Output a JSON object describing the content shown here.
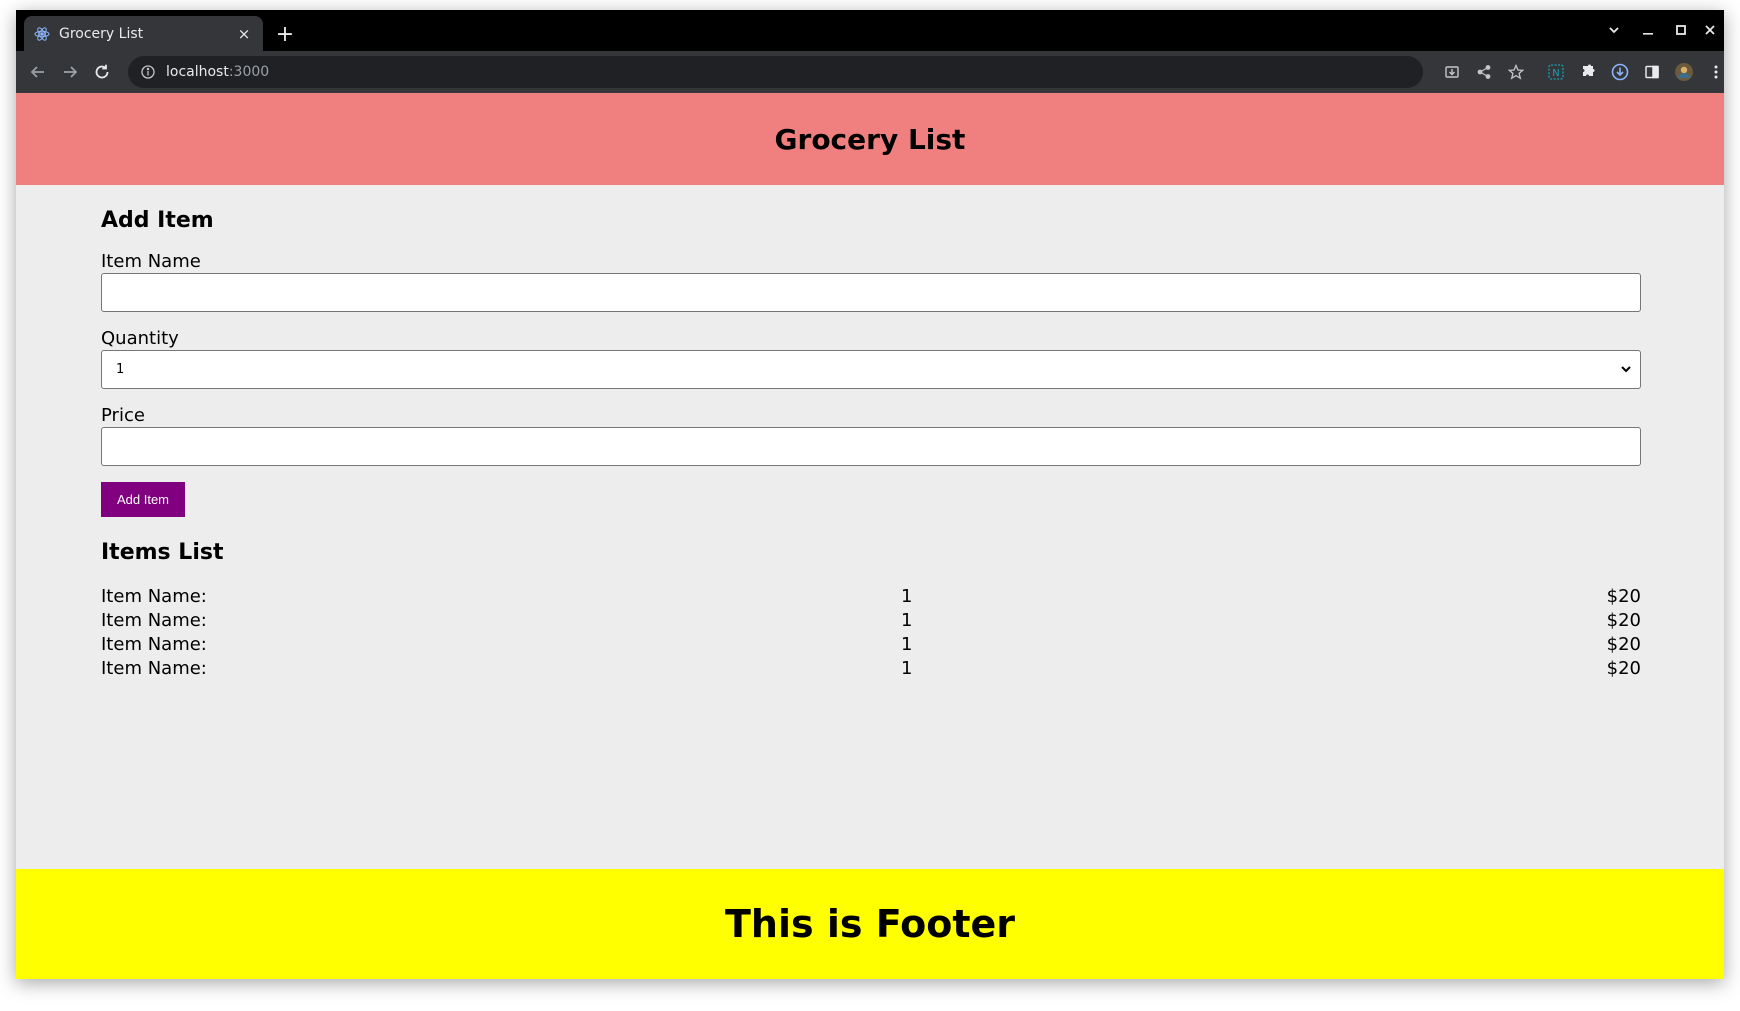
{
  "browser": {
    "tab_title": "Grocery List",
    "tab_close": "×",
    "new_tab": "+",
    "url_host": "localhost",
    "url_port": ":3000"
  },
  "header": {
    "title": "Grocery List"
  },
  "form": {
    "title": "Add Item",
    "item_name_label": "Item Name",
    "item_name_value": "",
    "quantity_label": "Quantity",
    "quantity_value": "1",
    "price_label": "Price",
    "price_value": "",
    "add_button_label": "Add Item"
  },
  "list": {
    "title": "Items List",
    "items": [
      {
        "name": "Item Name:",
        "quantity": "1",
        "price": "$20"
      },
      {
        "name": "Item Name:",
        "quantity": "1",
        "price": "$20"
      },
      {
        "name": "Item Name:",
        "quantity": "1",
        "price": "$20"
      },
      {
        "name": "Item Name:",
        "quantity": "1",
        "price": "$20"
      }
    ]
  },
  "footer": {
    "text": "This is Footer"
  },
  "colors": {
    "header_bg": "#f08080",
    "footer_bg": "#ffff00",
    "button_bg": "#800080",
    "page_bg": "#ededed"
  },
  "icons": {
    "tab_favicon": "react-icon",
    "back": "arrow-left-icon",
    "forward": "arrow-right-icon",
    "reload": "reload-icon",
    "site_info": "info-icon",
    "install": "install-icon",
    "share": "share-icon",
    "bookmark": "star-icon",
    "extension_n": "extension-n-icon",
    "extensions": "puzzle-icon",
    "download": "download-icon",
    "side_panel": "side-panel-icon",
    "profile": "avatar",
    "menu": "kebab-menu-icon"
  }
}
